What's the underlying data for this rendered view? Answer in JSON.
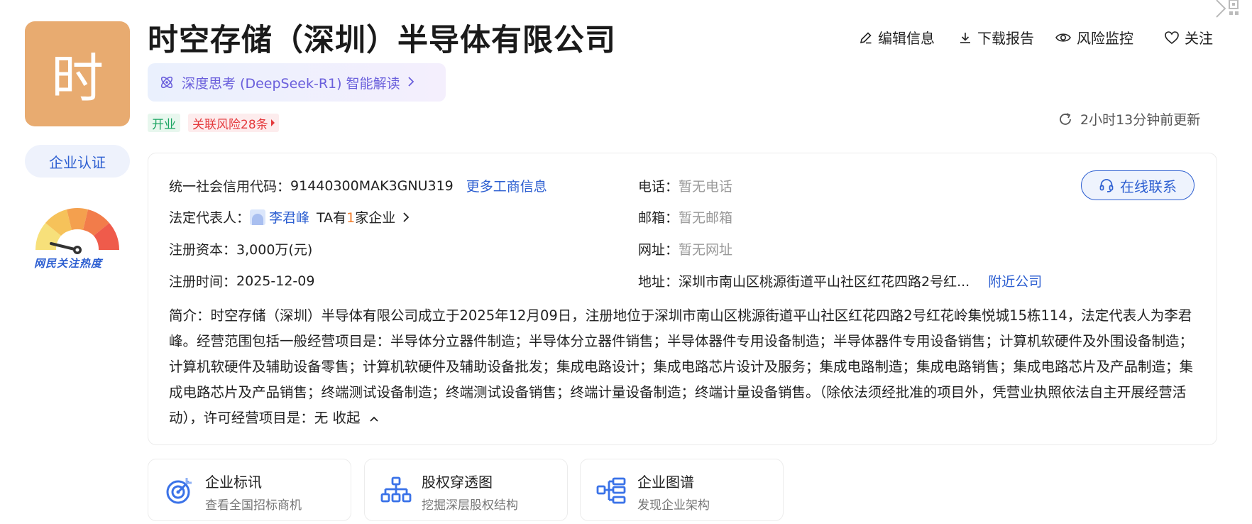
{
  "company": {
    "logo_char": "时",
    "name": "时空存储（深圳）半导体有限公司",
    "cert_label": "企业认证",
    "heat_label": "网民关注热度",
    "status_tag": "开业",
    "risk_tag": "关联风险28条"
  },
  "ai": {
    "label": "深度思考 (DeepSeek-R1) 智能解读"
  },
  "actions": {
    "edit": "编辑信息",
    "download": "下载报告",
    "monitor": "风险监控",
    "follow": "关注"
  },
  "updated_text": "2小时13分钟前更新",
  "info": {
    "credit_label": "统一社会信用代码：",
    "credit_value": "91440300MAK3GNU319",
    "more_info": "更多工商信息",
    "legal_label": "法定代表人：",
    "legal_name": "李君峰",
    "ta_prefix": "TA有",
    "ta_count": "1",
    "ta_suffix": "家企业",
    "capital_label": "注册资本：",
    "capital_value": "3,000万(元)",
    "date_label": "注册时间：",
    "date_value": "2025-12-09",
    "phone_label": "电话：",
    "phone_value": "暂无电话",
    "email_label": "邮箱：",
    "email_value": "暂无邮箱",
    "web_label": "网址：",
    "web_value": "暂无网址",
    "addr_label": "地址：",
    "addr_value": "深圳市南山区桃源街道平山社区红花四路2号红...",
    "nearby": "附近公司",
    "contact_button": "在线联系"
  },
  "intro": {
    "text": "简介：时空存储（深圳）半导体有限公司成立于2025年12月09日，注册地位于深圳市南山区桃源街道平山社区红花四路2号红花岭集悦城15栋114，法定代表人为李君峰。经营范围包括一般经营项目是：半导体分立器件制造；半导体分立器件销售；半导体器件专用设备制造；半导体器件专用设备销售；计算机软硬件及外围设备制造；计算机软硬件及辅助设备零售；计算机软硬件及辅助设备批发；集成电路设计；集成电路芯片设计及服务；集成电路制造；集成电路销售；集成电路芯片及产品制造；集成电路芯片及产品销售；终端测试设备制造；终端测试设备销售；终端计量设备制造；终端计量设备销售。（除依法须经批准的项目外，凭营业执照依法自主开展经营活动），许可经营项目是：无 ",
    "collapse": "收起"
  },
  "features": [
    {
      "title": "企业标讯",
      "subtitle": "查看全国招标商机"
    },
    {
      "title": "股权穿透图",
      "subtitle": "挖掘深层股权结构"
    },
    {
      "title": "企业图谱",
      "subtitle": "发现企业架构"
    }
  ],
  "colors": {
    "accent": "#2d5fd1",
    "logo_bg": "#e8ab70",
    "risk": "#e4393c",
    "open": "#19a461",
    "ai": "#6a5fdc"
  }
}
